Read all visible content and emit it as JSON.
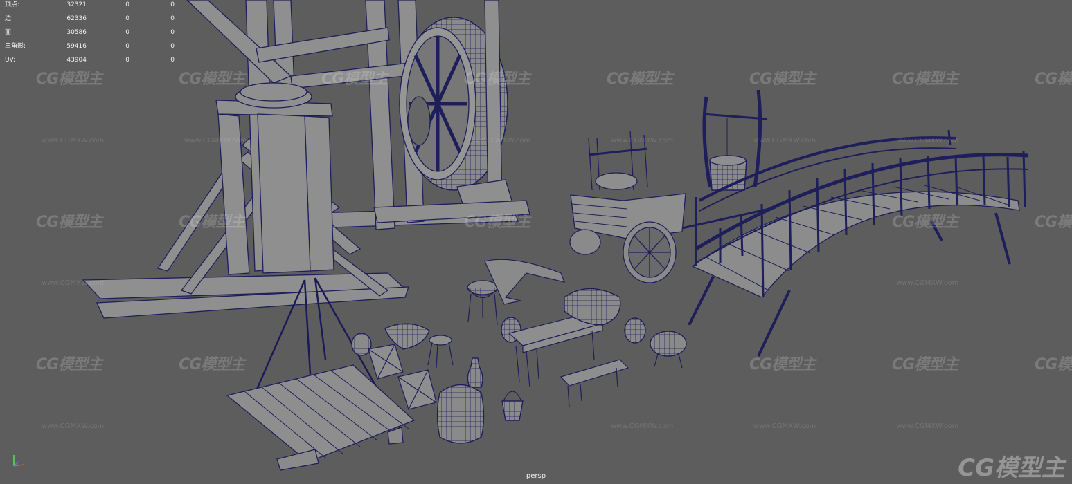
{
  "hud": {
    "rows": [
      {
        "label": "顶点:",
        "v1": "32321",
        "v2": "0",
        "v3": "0"
      },
      {
        "label": "边:",
        "v1": "62336",
        "v2": "0",
        "v3": "0"
      },
      {
        "label": "面:",
        "v1": "30586",
        "v2": "0",
        "v3": "0"
      },
      {
        "label": "三角形:",
        "v1": "59416",
        "v2": "0",
        "v3": "0"
      },
      {
        "label": "UV:",
        "v1": "43904",
        "v2": "0",
        "v3": "0"
      }
    ]
  },
  "viewport": {
    "camera": "persp"
  },
  "watermark": {
    "logo": "CG模型主",
    "url": "www.CGMXW.com"
  },
  "colors": {
    "background": "#5d5d5d",
    "mesh_fill": "#8e8e8e",
    "wire": "#1a1a58",
    "hud_text": "#f2f2f2"
  },
  "icons": {
    "axis": "view-axis-icon"
  }
}
